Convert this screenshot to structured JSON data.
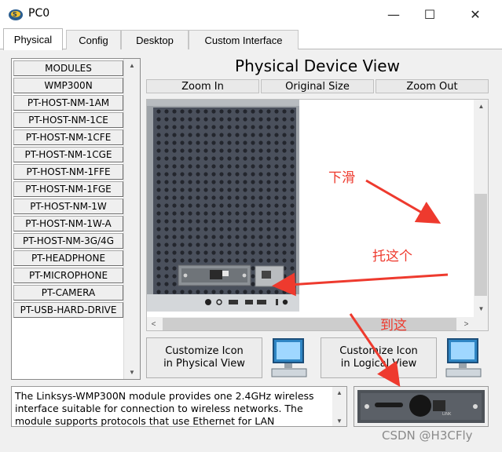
{
  "window": {
    "title": "PC0",
    "minimize_symbol": "—",
    "maximize_symbol": "☐",
    "close_symbol": "✕"
  },
  "tabs": [
    {
      "label": "Physical",
      "active": true
    },
    {
      "label": "Config",
      "active": false
    },
    {
      "label": "Desktop",
      "active": false
    },
    {
      "label": "Custom Interface",
      "active": false
    }
  ],
  "modules": [
    "MODULES",
    "WMP300N",
    "PT-HOST-NM-1AM",
    "PT-HOST-NM-1CE",
    "PT-HOST-NM-1CFE",
    "PT-HOST-NM-1CGE",
    "PT-HOST-NM-1FFE",
    "PT-HOST-NM-1FGE",
    "PT-HOST-NM-1W",
    "PT-HOST-NM-1W-A",
    "PT-HOST-NM-3G/4G",
    "PT-HEADPHONE",
    "PT-MICROPHONE",
    "PT-CAMERA",
    "PT-USB-HARD-DRIVE"
  ],
  "physical_view": {
    "title": "Physical Device View",
    "zoom_in": "Zoom In",
    "original_size": "Original Size",
    "zoom_out": "Zoom Out"
  },
  "customize": {
    "physical_label": "Customize Icon in Physical View",
    "logical_label": "Customize Icon in Logical View"
  },
  "description": "The Linksys-WMP300N module provides one 2.4GHz wireless interface suitable for connection to wireless networks. The module supports protocols that use Ethernet for LAN",
  "annotations": {
    "scroll_down": "下滑",
    "drag_this": "托这个",
    "to_here": "到这",
    "color": "#ee3a2e"
  },
  "watermark": "CSDN @H3CFly",
  "icons": {
    "app": "packet-tracer-icon",
    "pc": "pc-monitor-icon",
    "preview": "wireless-module-image"
  }
}
